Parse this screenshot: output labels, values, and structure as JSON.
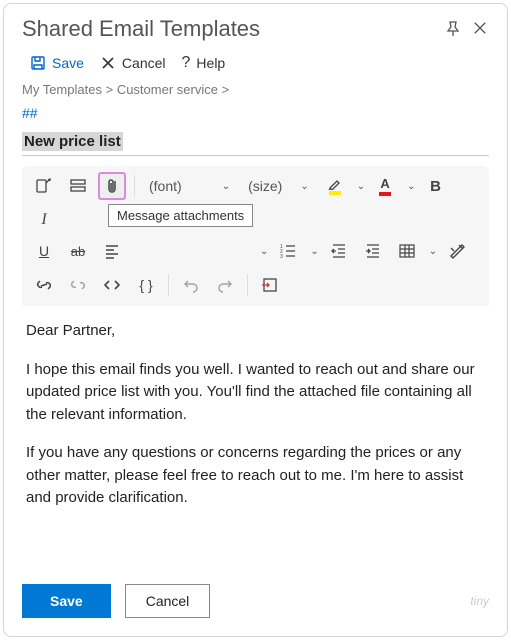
{
  "header": {
    "title": "Shared Email Templates"
  },
  "topbar": {
    "save": "Save",
    "cancel": "Cancel",
    "help": "Help"
  },
  "breadcrumbs": {
    "root": "My Templates",
    "folder": "Customer service",
    "sep": ">"
  },
  "tag_marker": "##",
  "template_title": "New price list",
  "toolbar": {
    "font_label": "(font)",
    "size_label": "(size)",
    "tooltip_attachment": "Message attachments"
  },
  "body": {
    "p1": "Dear Partner,",
    "p2": "I hope this email finds you well. I wanted to reach out and share our updated price list with you. You'll find the attached file containing all the relevant information.",
    "p3": "If you have any questions or concerns regarding the prices or any other matter, please feel free to reach out to me. I'm here to assist and provide clarification."
  },
  "footer": {
    "save": "Save",
    "cancel": "Cancel",
    "tiny": "tiny"
  }
}
